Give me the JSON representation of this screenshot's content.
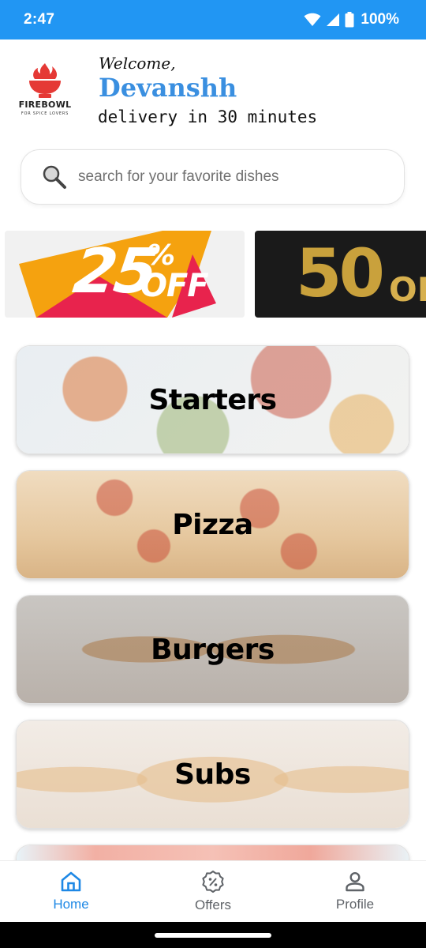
{
  "status_bar": {
    "time": "2:47",
    "battery": "100%"
  },
  "header": {
    "logo_name": "FIREBOWL",
    "logo_tagline": "FOR SPICE LOVERS",
    "welcome": "Welcome,",
    "user_name": "Devanshh",
    "delivery": "delivery in 30 minutes"
  },
  "search": {
    "placeholder": "search for your favorite dishes",
    "value": ""
  },
  "banners": [
    {
      "main": "25",
      "pct": "%",
      "off": "OFF"
    },
    {
      "main": "50",
      "pct": "%",
      "off": "OF"
    }
  ],
  "categories": [
    {
      "label": "Starters"
    },
    {
      "label": "Pizza"
    },
    {
      "label": "Burgers"
    },
    {
      "label": "Subs"
    },
    {
      "label": ""
    }
  ],
  "bottom_nav": {
    "items": [
      {
        "label": "Home",
        "icon": "home-icon",
        "active": true
      },
      {
        "label": "Offers",
        "icon": "offers-badge-icon",
        "active": false
      },
      {
        "label": "Profile",
        "icon": "person-icon",
        "active": false
      }
    ]
  },
  "colors": {
    "status_bar": "#2196f3",
    "accent": "#1e88e5",
    "user_name": "#3a8fe0",
    "logo_red": "#e53935"
  }
}
